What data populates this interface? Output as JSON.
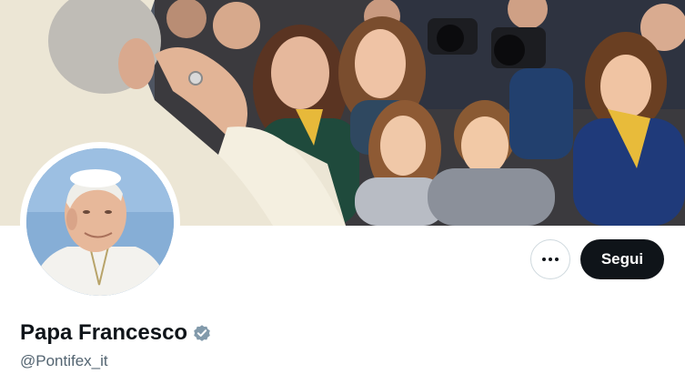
{
  "profile": {
    "display_name": "Papa Francesco",
    "handle": "@Pontifex_it",
    "verified_icon": "verified-badge-icon",
    "verified_color": "#829aab"
  },
  "actions": {
    "more_icon": "more-options-icon",
    "follow_label": "Segui"
  },
  "colors": {
    "text_primary": "#0f1419",
    "text_secondary": "#536471",
    "follow_bg": "#0f1419",
    "border": "#cfd9de"
  }
}
